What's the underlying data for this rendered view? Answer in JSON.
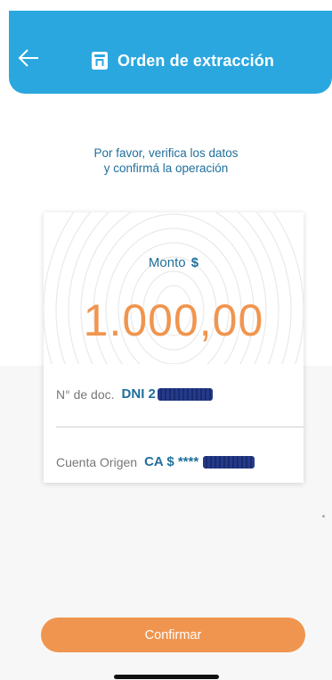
{
  "header": {
    "title": "Orden de extracción",
    "back_icon": "arrow-left-icon",
    "title_icon": "atm-icon",
    "color": "#2ba7df"
  },
  "message": {
    "line1": "Por favor, verifica los datos",
    "line2": "y confirmá la operación"
  },
  "amount": {
    "label": "Monto",
    "currency": "$",
    "value": "1.000,00",
    "color": "#f0954f"
  },
  "details": {
    "doc_label": "N° de doc.",
    "doc_prefix": "DNI 2",
    "account_label": "Cuenta Origen",
    "account_prefix": "CA $ ****"
  },
  "actions": {
    "confirm_label": "Confirmar"
  }
}
